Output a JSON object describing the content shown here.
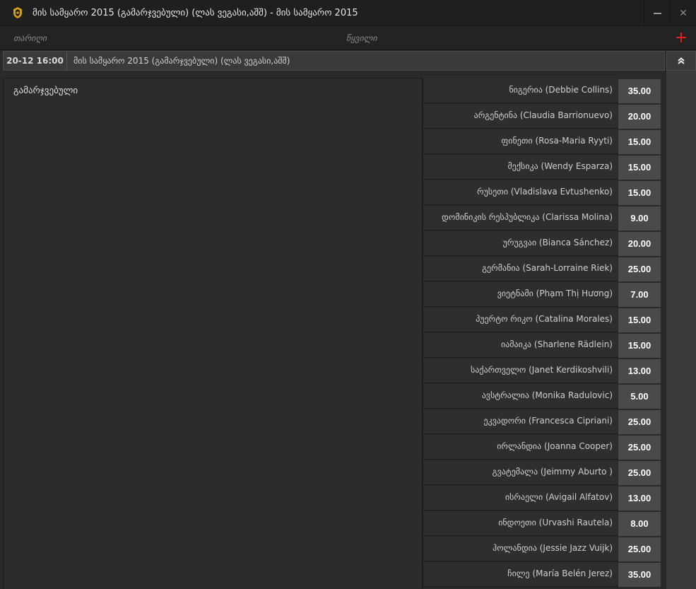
{
  "window": {
    "title": "მის სამყარო 2015 (გამარჯვებული) (ლას ვეგასი,აშშ) - მის სამყარო 2015",
    "minimize_glyph": "",
    "close_glyph": "✕"
  },
  "columns": {
    "date": "თარიღი",
    "market": "წყვილი"
  },
  "event": {
    "time": "20-12 16:00",
    "name": "მის სამყარო 2015 (გამარჯვებული) (ლას ვეგასი,აშშ)"
  },
  "market": {
    "label": "გამარჯვებული"
  },
  "selections": [
    {
      "name": "ნიგერია (Debbie Collins)",
      "odd": "35.00"
    },
    {
      "name": "არგენტინა (Claudia Barrionuevo)",
      "odd": "20.00"
    },
    {
      "name": "ფინეთი (Rosa-Maria Ryyti)",
      "odd": "15.00"
    },
    {
      "name": "მექსიკა (Wendy Esparza)",
      "odd": "15.00"
    },
    {
      "name": "რუსეთი (Vladislava Evtushenko)",
      "odd": "15.00"
    },
    {
      "name": "დომინიკის რესპუბლიკა (Clarissa Molina)",
      "odd": "9.00"
    },
    {
      "name": "ურუგვაი (Bianca Sánchez)",
      "odd": "20.00"
    },
    {
      "name": "გერმანია (Sarah-Lorraine Riek)",
      "odd": "25.00"
    },
    {
      "name": "ვიეტნამი (Phạm Thị Hương)",
      "odd": "7.00"
    },
    {
      "name": "პუერტო რიკო (Catalina Morales)",
      "odd": "15.00"
    },
    {
      "name": "იამაიკა (Sharlene Rädlein)",
      "odd": "15.00"
    },
    {
      "name": "საქართველო (Janet Kerdikoshvili)",
      "odd": "13.00"
    },
    {
      "name": "ავსტრალია (Monika Radulovic)",
      "odd": "5.00"
    },
    {
      "name": "ეკვადორი (Francesca Cipriani)",
      "odd": "25.00"
    },
    {
      "name": "ირლანდია (Joanna Cooper)",
      "odd": "25.00"
    },
    {
      "name": "გვატემალა (Jeimmy Aburto )",
      "odd": "25.00"
    },
    {
      "name": "ისრაელი (Avigail Alfatov)",
      "odd": "13.00"
    },
    {
      "name": "ინდოეთი (Urvashi Rautela)",
      "odd": "8.00"
    },
    {
      "name": "ჰოლანდია (Jessie Jazz Vuijk)",
      "odd": "25.00"
    },
    {
      "name": "ჩილე (María Belén Jerez)",
      "odd": "35.00"
    }
  ]
}
